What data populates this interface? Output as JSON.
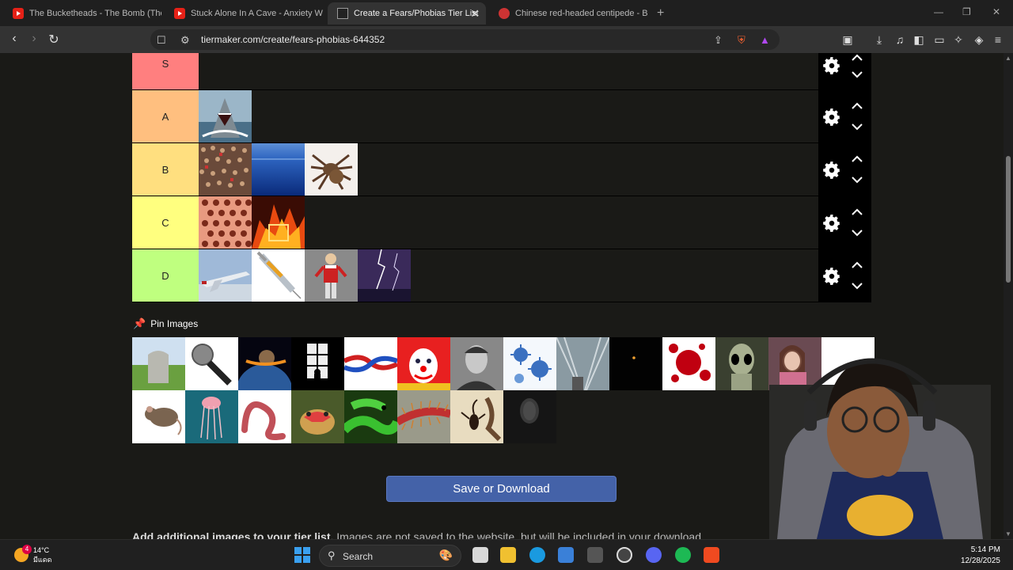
{
  "browser": {
    "tabs": [
      {
        "title": "The Bucketheads - The Bomb (These",
        "icon": "youtube-icon",
        "active": false
      },
      {
        "title": "Stuck Alone In A Cave - Anxiety Warr",
        "icon": "youtube-icon",
        "active": false
      },
      {
        "title": "Create a Fears/Phobias Tier List",
        "icon": "tiermaker-icon",
        "active": true
      },
      {
        "title": "Chinese red-headed centipede - Brav",
        "icon": "brave-icon",
        "active": false
      }
    ],
    "url": "tiermaker.com/create/fears-phobias-644352",
    "brave_shield_count": "5",
    "rewards_count": "1"
  },
  "tiers": [
    {
      "label": "S",
      "color": "#ff7f7f",
      "items": []
    },
    {
      "label": "A",
      "color": "#ffbf7f",
      "items": [
        "shark"
      ]
    },
    {
      "label": "B",
      "color": "#ffdf7f",
      "items": [
        "crowd",
        "ocean",
        "tarantula"
      ]
    },
    {
      "label": "C",
      "color": "#ffff7f",
      "items": [
        "holes",
        "fire"
      ]
    },
    {
      "label": "D",
      "color": "#bfff7f",
      "items": [
        "airplane",
        "syringe",
        "puppet",
        "lightning"
      ]
    }
  ],
  "pin_images_label": "Pin Images",
  "pool": [
    "gravestone",
    "microphone",
    "asteroid",
    "window-silhouette",
    "knot",
    "clown",
    "man-portrait",
    "virus",
    "height",
    "darkness",
    "blood",
    "alien",
    "scared-girl",
    "blank",
    "mouse",
    "jellyfish",
    "worm",
    "lizard",
    "snake",
    "centipede",
    "scorpion",
    "ghost"
  ],
  "save_button": "Save or Download",
  "add_text_bold": "Add additional images to your tier list.",
  "add_text_rest": " Images are not saved to the website, but will be included in your download.",
  "taskbar": {
    "weather_temp": "14°C",
    "weather_desc": "มีแดด",
    "weather_badge": "4",
    "search_label": "Search",
    "time": "5:14 PM",
    "date": "12/28/2025"
  }
}
